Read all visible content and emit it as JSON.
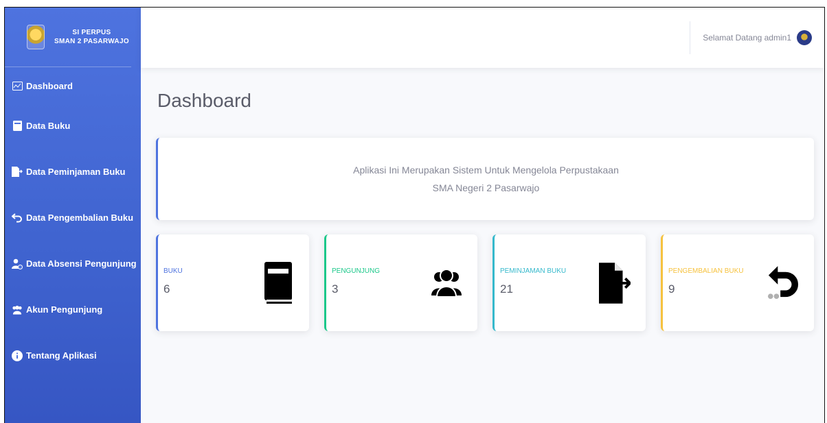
{
  "sidebar": {
    "brand_line1": "SI PERPUS",
    "brand_line2": "SMAN 2 PASARWAJO",
    "items": [
      {
        "label": "Dashboard",
        "icon": "chart-area-icon"
      },
      {
        "label": "Data Buku",
        "icon": "book-icon"
      },
      {
        "label": "Data Peminjaman Buku",
        "icon": "file-export-icon"
      },
      {
        "label": "Data Pengembalian Buku",
        "icon": "undo-icon"
      },
      {
        "label": "Data Absensi Pengunjung",
        "icon": "user-clock-icon"
      },
      {
        "label": "Akun Pengunjung",
        "icon": "users-icon"
      },
      {
        "label": "Tentang Aplikasi",
        "icon": "info-circle-icon"
      }
    ]
  },
  "topbar": {
    "welcome": "Selamat Datang admin1"
  },
  "main": {
    "title": "Dashboard",
    "info_line1": "Aplikasi Ini Merupakan Sistem Untuk Mengelola Perpustakaan",
    "info_line2": "SMA Negeri 2 Pasarwajo"
  },
  "cards": [
    {
      "label": "BUKU",
      "value": "6",
      "color": "#4e73df",
      "icon": "book-icon"
    },
    {
      "label": "PENGUNJUNG",
      "value": "3",
      "color": "#1cc88a",
      "icon": "users-icon"
    },
    {
      "label": "PEMINJAMAN BUKU",
      "value": "21",
      "color": "#36b9cc",
      "icon": "file-export-icon"
    },
    {
      "label": "PENGEMBALIAN BUKU",
      "value": "9",
      "color": "#f6c23e",
      "icon": "undo-icon"
    }
  ]
}
